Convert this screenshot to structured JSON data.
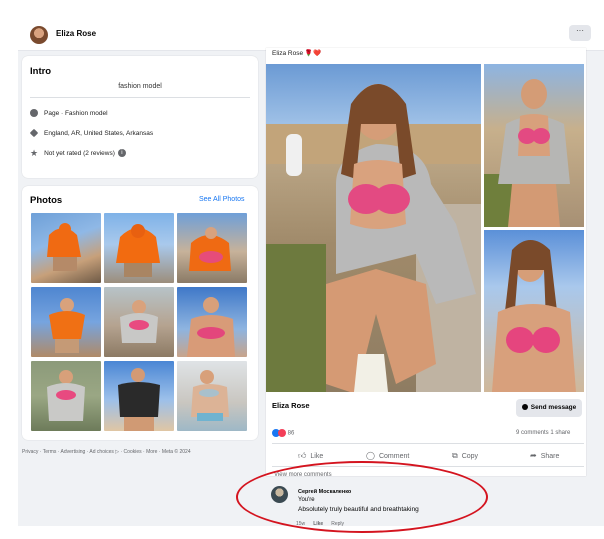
{
  "header": {
    "profile_name": "Eliza Rose",
    "more_label": "···"
  },
  "intro": {
    "title": "Intro",
    "bio": "fashion model",
    "rows": [
      {
        "icon": "info-icon",
        "text": "Page · Fashion model"
      },
      {
        "icon": "location-icon",
        "text": "England, AR, United States, Arkansas"
      },
      {
        "icon": "star-icon",
        "text": "Not yet rated (2 reviews)"
      }
    ]
  },
  "photos": {
    "title": "Photos",
    "see_all": "See All Photos"
  },
  "footer": "Privacy · Terms · Advertising · Ad choices ▷ · Cookies · More · Meta © 2024",
  "post": {
    "caption": "Eliza Rose 🌹❤️",
    "author": "Eliza Rose",
    "send_message": "Send message",
    "reaction_count": "86",
    "comments_shares": "9 comments  1 share",
    "actions": {
      "like": "Like",
      "comment": "Comment",
      "copy": "Copy",
      "share": "Share"
    }
  },
  "comments": {
    "view_more": "View more comments",
    "items": [
      {
        "author": "Сергей Москаленко",
        "line1": "You're",
        "line2": "Absolutely truly beautiful and breathtaking",
        "time": "15w",
        "like": "Like",
        "reply": "Reply"
      }
    ]
  },
  "colors": {
    "accent": "#1877f2",
    "highlight_oval": "#d4141f",
    "pink": "#e0457b"
  }
}
